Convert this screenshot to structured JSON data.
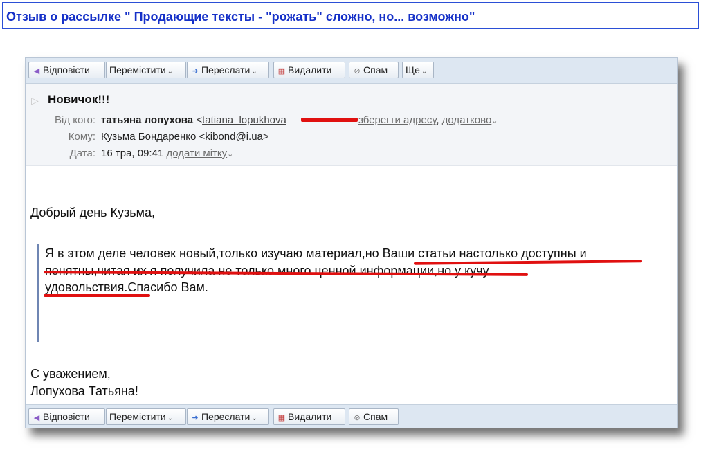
{
  "banner": {
    "title": "Отзыв о рассылке \" Продающие тексты - \"рожать\" сложно, но... возможно\""
  },
  "toolbar": {
    "reply": "Відповісти",
    "move": "Перемістити",
    "forward": "Переслати",
    "delete": "Видалити",
    "spam": "Спам",
    "more": "Ще"
  },
  "message": {
    "subject": "Новичок!!!",
    "from_label": "Від кого:",
    "from_name": "татьяна лопухова",
    "from_email": "tatiana_lopukhova",
    "save_address": "зберегти адресу",
    "more_link": "додатково",
    "to_label": "Кому:",
    "to_value": "Кузьма Бондаренко <kibond@i.ua>",
    "date_label": "Дата:",
    "date_value": "16 тра, 09:41",
    "add_label": "додати мітку"
  },
  "body": {
    "greeting": "Добрый день Кузьма,",
    "quote_line1": "Я в этом деле человек новый,только изучаю материал,но Ваши статьи настолько доступны и",
    "quote_line2": "понятны,читая их я получила не только много ценной информации,но у кучу",
    "quote_line3": "удовольствия.Спасибо Вам.",
    "closing1": "С уважением,",
    "closing2": "Лопухова Татьяна!"
  },
  "colors": {
    "banner_text": "#1530c8",
    "highlight": "#e01010",
    "toolbar_bg": "#dde7f2"
  }
}
